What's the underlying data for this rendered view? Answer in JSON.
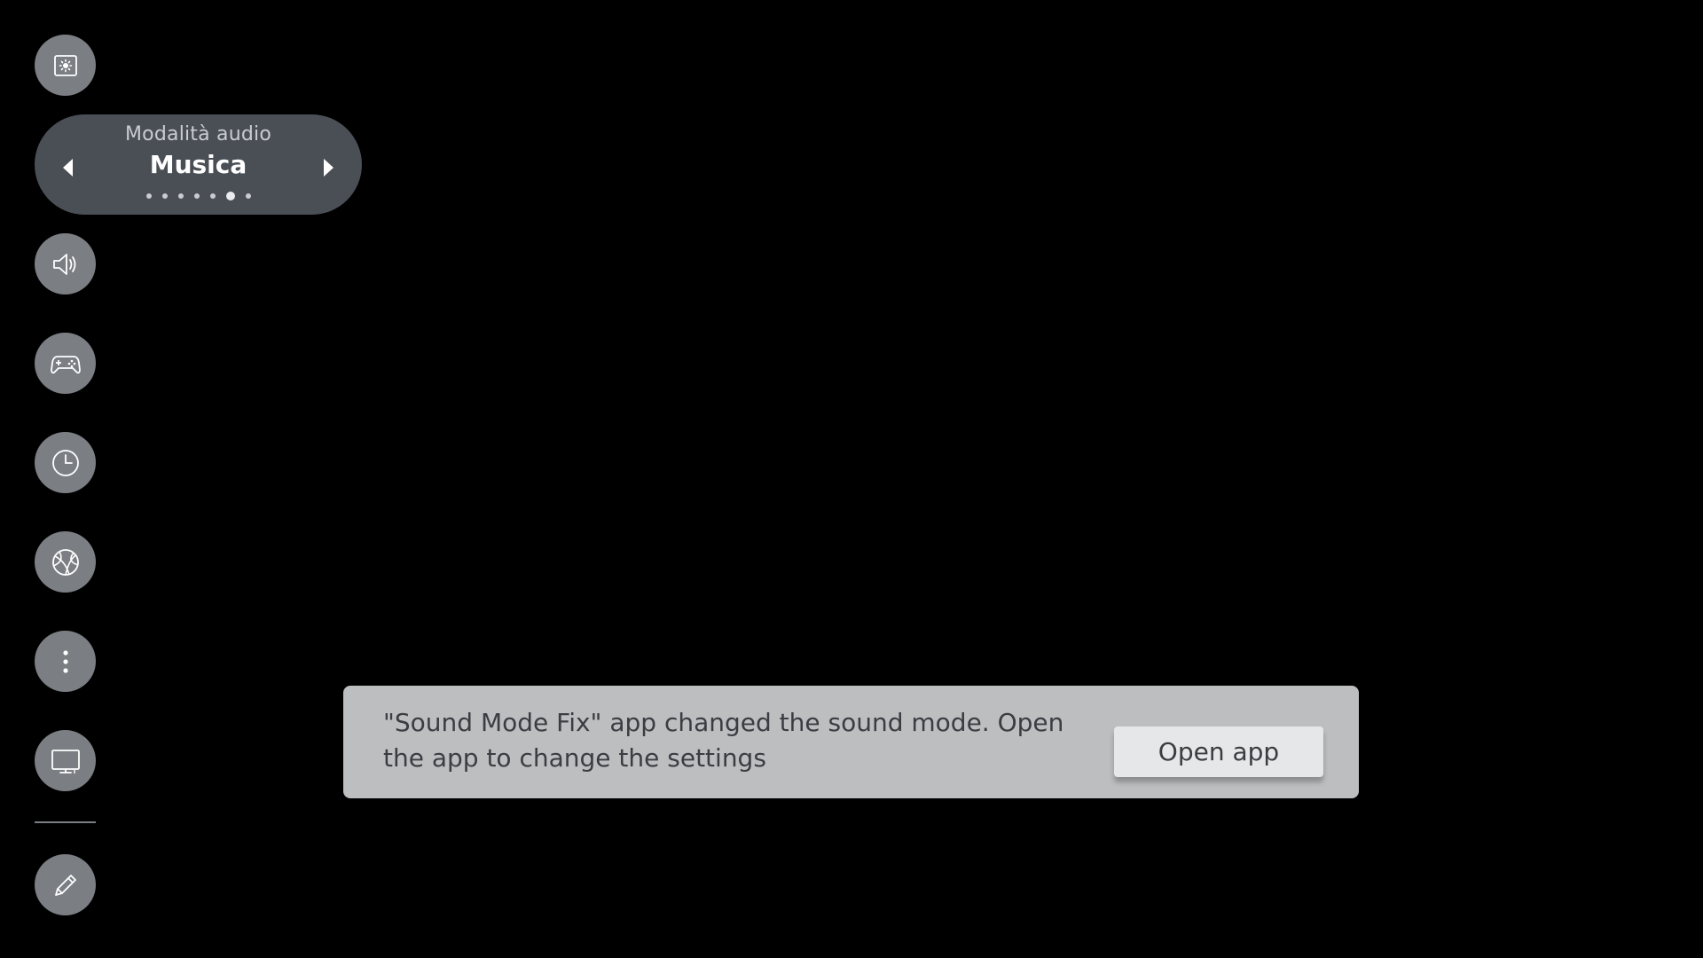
{
  "sidebar": {
    "items": [
      {
        "icon": "picture-mode-icon"
      },
      {
        "icon": "sound-icon"
      },
      {
        "icon": "game-controller-icon"
      },
      {
        "icon": "clock-icon"
      },
      {
        "icon": "sports-ball-icon"
      },
      {
        "icon": "more-options-icon"
      },
      {
        "icon": "screen-output-icon"
      },
      {
        "icon": "edit-pencil-icon"
      }
    ]
  },
  "audio_mode": {
    "label": "Modalità audio",
    "value": "Musica",
    "option_count": 7,
    "selected_index": 5
  },
  "toast": {
    "message": "\"Sound Mode Fix\" app changed the sound mode. Open the app to change the settings",
    "button_label": "Open app"
  },
  "colors": {
    "background": "#000000",
    "button": "#7b7e83",
    "pill": "#4a4f56",
    "toast": "#bdbec0",
    "toast_button": "#e6e7e8"
  }
}
